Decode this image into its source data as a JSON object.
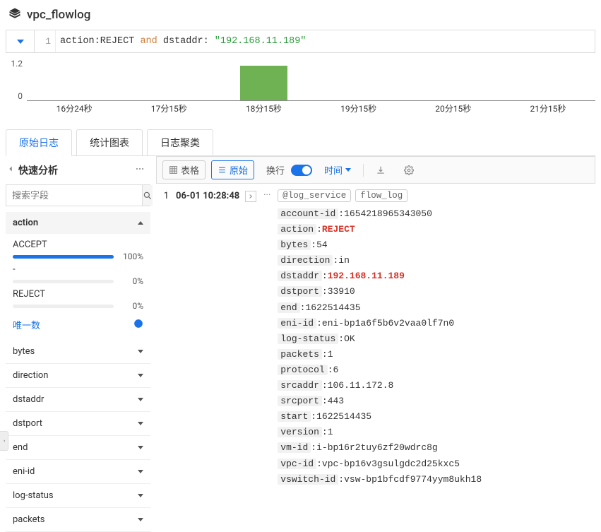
{
  "header": {
    "title": "vpc_flowlog"
  },
  "query": {
    "lineno": "1",
    "field1": "action",
    "val1": "REJECT",
    "op": "and",
    "field2": "dstaddr",
    "val2": "\"192.168.11.189\""
  },
  "chart_data": {
    "type": "bar",
    "categories": [
      "16分24秒",
      "17分15秒",
      "18分15秒",
      "19分15秒",
      "20分15秒",
      "21分15秒"
    ],
    "values": [
      0,
      0,
      1,
      0,
      0,
      0
    ],
    "yticks": [
      "1.2",
      "0"
    ],
    "title": "",
    "xlabel": "",
    "ylabel": "",
    "ylim": [
      0,
      1.2
    ]
  },
  "tabs": {
    "raw": "原始日志",
    "chart": "统计图表",
    "cluster": "日志聚类"
  },
  "sidebar": {
    "title": "快速分析",
    "search_placeholder": "搜索字段",
    "expanded_facet": {
      "name": "action",
      "items": [
        {
          "label": "ACCEPT",
          "pct": "100%",
          "fill": 100
        },
        {
          "label": "-",
          "pct": "0%",
          "fill": 0
        },
        {
          "label": "REJECT",
          "pct": "0%",
          "fill": 0
        }
      ],
      "unique_label": "唯一数"
    },
    "collapsed_facets": [
      "bytes",
      "direction",
      "dstaddr",
      "dstport",
      "end",
      "eni-id",
      "log-status",
      "packets"
    ]
  },
  "toolbar": {
    "table": "表格",
    "raw": "原始",
    "wrap": "换行",
    "time": "时间"
  },
  "log": {
    "index": "1",
    "timestamp": "06-01 10:28:48",
    "tags": {
      "service_key": "@log_service",
      "service_val": "flow_log"
    },
    "fields": [
      {
        "k": "account-id",
        "v": "1654218965343050",
        "hl": false
      },
      {
        "k": "action",
        "v": "REJECT",
        "hl": true
      },
      {
        "k": "bytes",
        "v": "54",
        "hl": false
      },
      {
        "k": "direction",
        "v": "in",
        "hl": false
      },
      {
        "k": "dstaddr",
        "v": "192.168.11.189",
        "hl": true
      },
      {
        "k": "dstport",
        "v": "33910",
        "hl": false
      },
      {
        "k": "end",
        "v": "1622514435",
        "hl": false
      },
      {
        "k": "eni-id",
        "v": "eni-bp1a6f5b6v2vaa0lf7n0",
        "hl": false
      },
      {
        "k": "log-status",
        "v": "OK",
        "hl": false
      },
      {
        "k": "packets",
        "v": "1",
        "hl": false
      },
      {
        "k": "protocol",
        "v": "6",
        "hl": false
      },
      {
        "k": "srcaddr",
        "v": "106.11.172.8",
        "hl": false
      },
      {
        "k": "srcport",
        "v": "443",
        "hl": false
      },
      {
        "k": "start",
        "v": "1622514435",
        "hl": false
      },
      {
        "k": "version",
        "v": "1",
        "hl": false
      },
      {
        "k": "vm-id",
        "v": "i-bp16r2tuy6zf20wdrc8g",
        "hl": false
      },
      {
        "k": "vpc-id",
        "v": "vpc-bp16v3gsulgdc2d25kxc5",
        "hl": false
      },
      {
        "k": "vswitch-id",
        "v": "vsw-bp1bfcdf9774yym8ukh18",
        "hl": false
      }
    ]
  }
}
